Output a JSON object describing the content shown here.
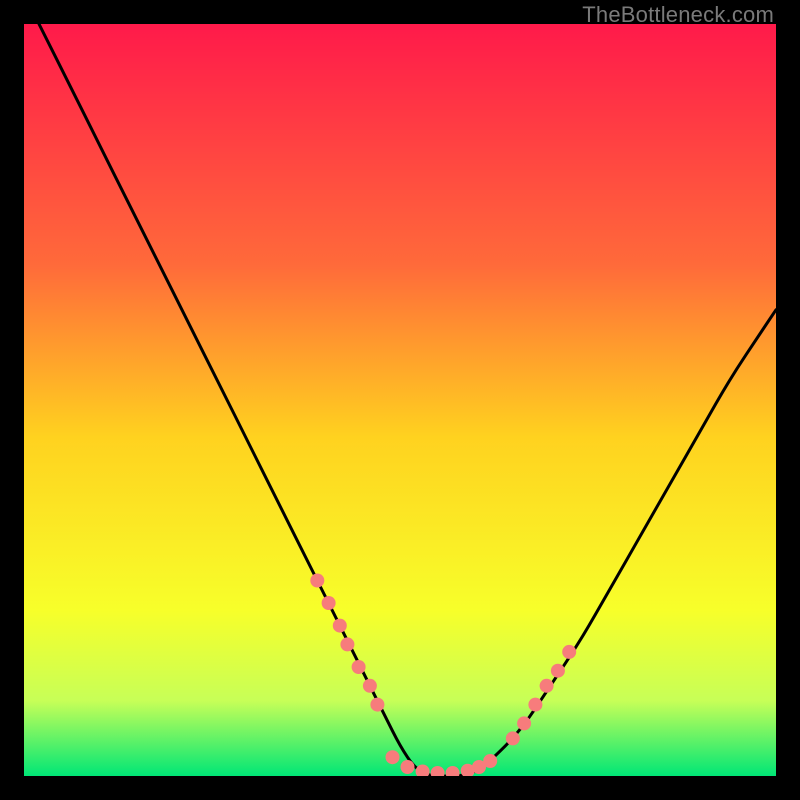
{
  "watermark": "TheBottleneck.com",
  "colors": {
    "background": "#000000",
    "curve": "#000000",
    "marker": "#f77c7c",
    "gradient_top": "#ff1a4a",
    "gradient_mid_upper": "#ff6a3a",
    "gradient_mid": "#ffd21f",
    "gradient_mid_lower": "#f7ff2a",
    "gradient_low": "#c7ff57",
    "gradient_bottom": "#00e676"
  },
  "chart_data": {
    "type": "line",
    "title": "",
    "xlabel": "",
    "ylabel": "",
    "xlim": [
      0,
      100
    ],
    "ylim": [
      0,
      100
    ],
    "curve": {
      "x": [
        2,
        6,
        10,
        14,
        18,
        22,
        26,
        30,
        34,
        38,
        42,
        46,
        48,
        50,
        52,
        54,
        56,
        58,
        60,
        62,
        66,
        70,
        74,
        78,
        82,
        86,
        90,
        94,
        98,
        100
      ],
      "y": [
        100,
        92,
        84,
        76,
        68,
        60,
        52,
        44,
        36,
        28,
        20,
        12,
        8,
        4,
        1,
        0,
        0,
        0,
        0.5,
        2,
        6,
        12,
        18,
        25,
        32,
        39,
        46,
        53,
        59,
        62
      ]
    },
    "series": [
      {
        "name": "markers-left",
        "x": [
          39,
          40.5,
          42,
          43,
          44.5,
          46,
          47
        ],
        "y": [
          26,
          23,
          20,
          17.5,
          14.5,
          12,
          9.5
        ]
      },
      {
        "name": "markers-bottom",
        "x": [
          49,
          51,
          53,
          55,
          57,
          59,
          60.5,
          62
        ],
        "y": [
          2.5,
          1.2,
          0.6,
          0.4,
          0.4,
          0.7,
          1.2,
          2
        ]
      },
      {
        "name": "markers-right",
        "x": [
          65,
          66.5,
          68,
          69.5,
          71,
          72.5
        ],
        "y": [
          5,
          7,
          9.5,
          12,
          14,
          16.5
        ]
      }
    ]
  }
}
